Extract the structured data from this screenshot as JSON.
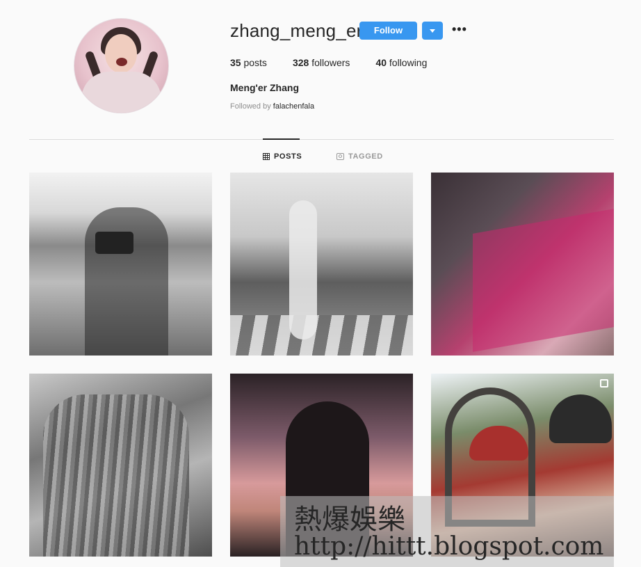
{
  "profile": {
    "username": "zhang_meng_er",
    "follow_label": "Follow",
    "more_icon": "more-options-icon",
    "stats": {
      "posts_count": "35",
      "posts_label": "posts",
      "followers_count": "328",
      "followers_label": "followers",
      "following_count": "40",
      "following_label": "following"
    },
    "full_name": "Meng'er Zhang",
    "followed_by_prefix": "Followed by",
    "followed_by_user": "falachenfala"
  },
  "tabs": [
    {
      "label": "POSTS",
      "icon": "grid-icon",
      "active": true
    },
    {
      "label": "TAGGED",
      "icon": "tag-icon",
      "active": false
    }
  ],
  "posts": [
    {
      "description": "photo",
      "multi": false
    },
    {
      "description": "photo",
      "multi": false
    },
    {
      "description": "photo",
      "multi": false
    },
    {
      "description": "photo",
      "multi": false
    },
    {
      "description": "photo",
      "multi": false
    },
    {
      "description": "photo",
      "multi": true
    }
  ],
  "watermark": {
    "title": "熱爆娛樂",
    "url": "http://hittt.blogspot.com"
  },
  "colors": {
    "accent": "#3897f0",
    "background": "#fafafa",
    "text": "#262626",
    "muted": "#8e8e8e"
  }
}
